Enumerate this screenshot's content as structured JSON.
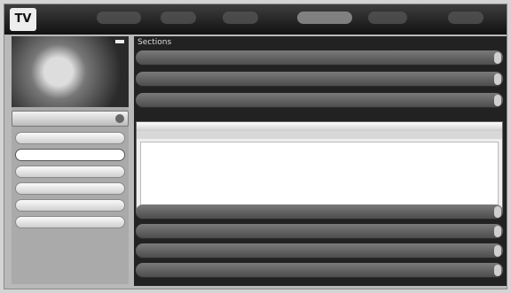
{
  "app": {
    "logo": "TV"
  },
  "topnav": {
    "items": [
      {
        "label": "",
        "active": false
      },
      {
        "label": "",
        "active": false
      },
      {
        "label": "",
        "active": false
      },
      {
        "label": "",
        "active": true
      },
      {
        "label": "",
        "active": false
      },
      {
        "label": "",
        "active": false
      }
    ]
  },
  "sidebar": {
    "header": "",
    "items": [
      {
        "label": "",
        "selected": false
      },
      {
        "label": "",
        "selected": true
      },
      {
        "label": "",
        "selected": false
      },
      {
        "label": "",
        "selected": false
      },
      {
        "label": "",
        "selected": false
      },
      {
        "label": "",
        "selected": false
      }
    ]
  },
  "main": {
    "title": "Sections",
    "rows_top": [
      {
        "title": "",
        "meta": ""
      },
      {
        "title": "",
        "meta": ""
      },
      {
        "title": "",
        "meta": ""
      }
    ],
    "expanded": {
      "title": "",
      "meta": "",
      "subtitle": "",
      "submeta": "",
      "description": ""
    },
    "rows_bottom": [
      {
        "title": "",
        "meta": ""
      },
      {
        "title": "",
        "meta": ""
      },
      {
        "title": "",
        "meta": ""
      },
      {
        "title": "",
        "meta": ""
      }
    ]
  }
}
